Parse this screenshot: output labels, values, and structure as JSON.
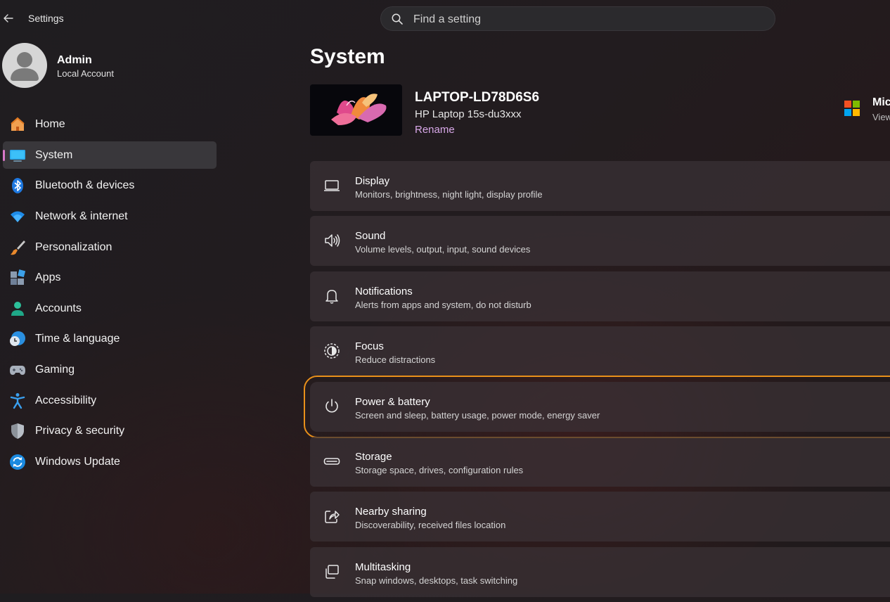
{
  "app": {
    "title": "Settings"
  },
  "search": {
    "placeholder": "Find a setting"
  },
  "profile": {
    "name": "Admin",
    "account_type": "Local Account"
  },
  "nav": {
    "items": [
      {
        "label": "Home",
        "icon": "home-icon"
      },
      {
        "label": "System",
        "icon": "system-icon",
        "active": true
      },
      {
        "label": "Bluetooth & devices",
        "icon": "bluetooth-icon"
      },
      {
        "label": "Network & internet",
        "icon": "wifi-icon"
      },
      {
        "label": "Personalization",
        "icon": "brush-icon"
      },
      {
        "label": "Apps",
        "icon": "apps-icon"
      },
      {
        "label": "Accounts",
        "icon": "person-icon"
      },
      {
        "label": "Time & language",
        "icon": "clock-globe-icon"
      },
      {
        "label": "Gaming",
        "icon": "gamepad-icon"
      },
      {
        "label": "Accessibility",
        "icon": "accessibility-icon"
      },
      {
        "label": "Privacy & security",
        "icon": "shield-icon"
      },
      {
        "label": "Windows Update",
        "icon": "update-icon"
      }
    ]
  },
  "main": {
    "title": "System",
    "device": {
      "name": "LAPTOP-LD78D6S6",
      "model": "HP Laptop 15s-du3xxx",
      "rename_label": "Rename"
    },
    "microsoft": {
      "title": "Mic",
      "subtitle": "View"
    },
    "cards": [
      {
        "title": "Display",
        "subtitle": "Monitors, brightness, night light, display profile",
        "icon": "monitor-icon"
      },
      {
        "title": "Sound",
        "subtitle": "Volume levels, output, input, sound devices",
        "icon": "speaker-icon"
      },
      {
        "title": "Notifications",
        "subtitle": "Alerts from apps and system, do not disturb",
        "icon": "bell-icon"
      },
      {
        "title": "Focus",
        "subtitle": "Reduce distractions",
        "icon": "focus-icon"
      },
      {
        "title": "Power & battery",
        "subtitle": "Screen and sleep, battery usage, power mode, energy saver",
        "icon": "power-icon",
        "highlighted": true
      },
      {
        "title": "Storage",
        "subtitle": "Storage space, drives, configuration rules",
        "icon": "storage-icon"
      },
      {
        "title": "Nearby sharing",
        "subtitle": "Discoverability, received files location",
        "icon": "share-icon"
      },
      {
        "title": "Multitasking",
        "subtitle": "Snap windows, desktops, task switching",
        "icon": "multitasking-icon"
      }
    ]
  },
  "colors": {
    "accent_indicator": "#d878c8",
    "highlight_outline": "#e9901a",
    "rename_link": "#d8a8e8"
  }
}
